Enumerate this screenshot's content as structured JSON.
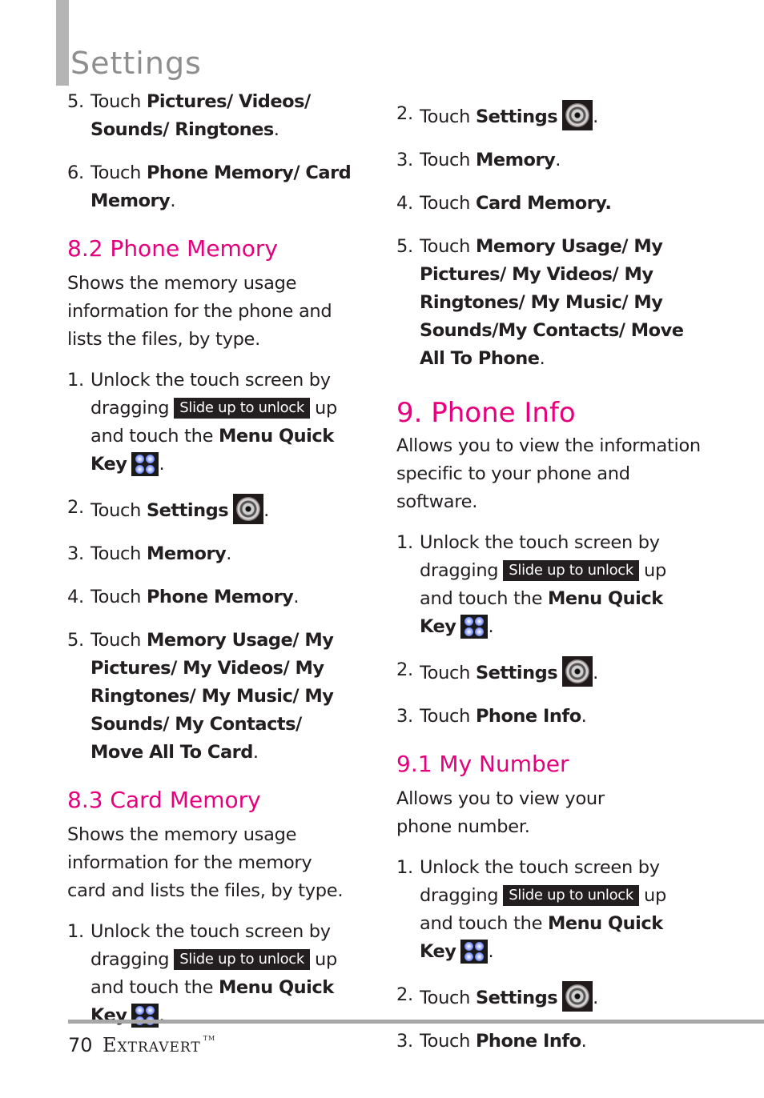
{
  "header": {
    "title": "Settings"
  },
  "left": {
    "cont_steps": [
      {
        "num": "5.",
        "pre": "Touch ",
        "bold": "Pictures/ Videos/ Sounds/ Ringtones",
        "post": "."
      },
      {
        "num": "6.",
        "pre": "Touch ",
        "bold": "Phone Memory/ Card Memory",
        "post": "."
      }
    ],
    "s82": {
      "heading": "8.2 Phone Memory",
      "desc": "Shows the memory usage information for the phone and lists the files, by type.",
      "step1": {
        "num": "1.",
        "a": "Unlock the touch screen by dragging",
        "slide": "Slide up to unlock",
        "b": "up and touch the",
        "bold": "Menu Quick Key",
        "post": "."
      },
      "step2": {
        "num": "2.",
        "pre": "Touch ",
        "bold": "Settings",
        "post": "."
      },
      "step3": {
        "num": "3.",
        "pre": "Touch ",
        "bold": "Memory",
        "post": "."
      },
      "step4": {
        "num": "4.",
        "pre": "Touch ",
        "bold": "Phone Memory",
        "post": "."
      },
      "step5": {
        "num": "5.",
        "pre": "Touch ",
        "bold": "Memory Usage/ My Pictures/ My Videos/ My Ringtones/ My Music/ My Sounds/ My Contacts/ Move All To Card",
        "post": "."
      }
    },
    "s83": {
      "heading": "8.3 Card Memory",
      "desc": "Shows the memory usage information for the memory card and lists the files, by type.",
      "step1": {
        "num": "1.",
        "a": "Unlock the touch screen by dragging",
        "slide": "Slide up to unlock",
        "b": "up and touch the",
        "bold": "Menu Quick Key",
        "post": "."
      }
    }
  },
  "right": {
    "cont_steps": [
      {
        "num": "2.",
        "pre": "Touch ",
        "bold": "Settings",
        "post": "."
      },
      {
        "num": "3.",
        "pre": "Touch ",
        "bold": "Memory",
        "post": "."
      },
      {
        "num": "4.",
        "pre": "Touch ",
        "bold": "Card Memory.",
        "post": ""
      },
      {
        "num": "5.",
        "pre": "Touch ",
        "bold": "Memory Usage/ My Pictures/ My Videos/ My Ringtones/ My Music/ My Sounds/My Contacts/ Move All To Phone",
        "post": "."
      }
    ],
    "s9": {
      "heading": "9. Phone Info",
      "desc": "Allows you to view the information specific to your phone and software.",
      "step1": {
        "num": "1.",
        "a": "Unlock the touch screen by dragging",
        "slide": "Slide up to unlock",
        "b": "up and touch the",
        "bold": "Menu Quick Key",
        "post": "."
      },
      "step2": {
        "num": "2.",
        "pre": "Touch ",
        "bold": "Settings",
        "post": "."
      },
      "step3": {
        "num": "3.",
        "pre": "Touch ",
        "bold": "Phone Info",
        "post": "."
      }
    },
    "s91": {
      "heading": "9.1 My Number",
      "desc": "Allows you to view your phone number.",
      "step1": {
        "num": "1.",
        "a": "Unlock the touch screen by dragging",
        "slide": "Slide up to unlock",
        "b": "up and touch the",
        "bold": "Menu Quick Key",
        "post": "."
      },
      "step2": {
        "num": "2.",
        "pre": "Touch ",
        "bold": "Settings",
        "post": "."
      },
      "step3": {
        "num": "3.",
        "pre": "Touch ",
        "bold": "Phone Info",
        "post": "."
      }
    }
  },
  "footer": {
    "page_number": "70",
    "brand": "Extravert",
    "trademark": "TM"
  },
  "colors": {
    "accent": "#e6007e",
    "title_gray": "#8e8e8e",
    "bar_gray": "#b5b5b5"
  }
}
